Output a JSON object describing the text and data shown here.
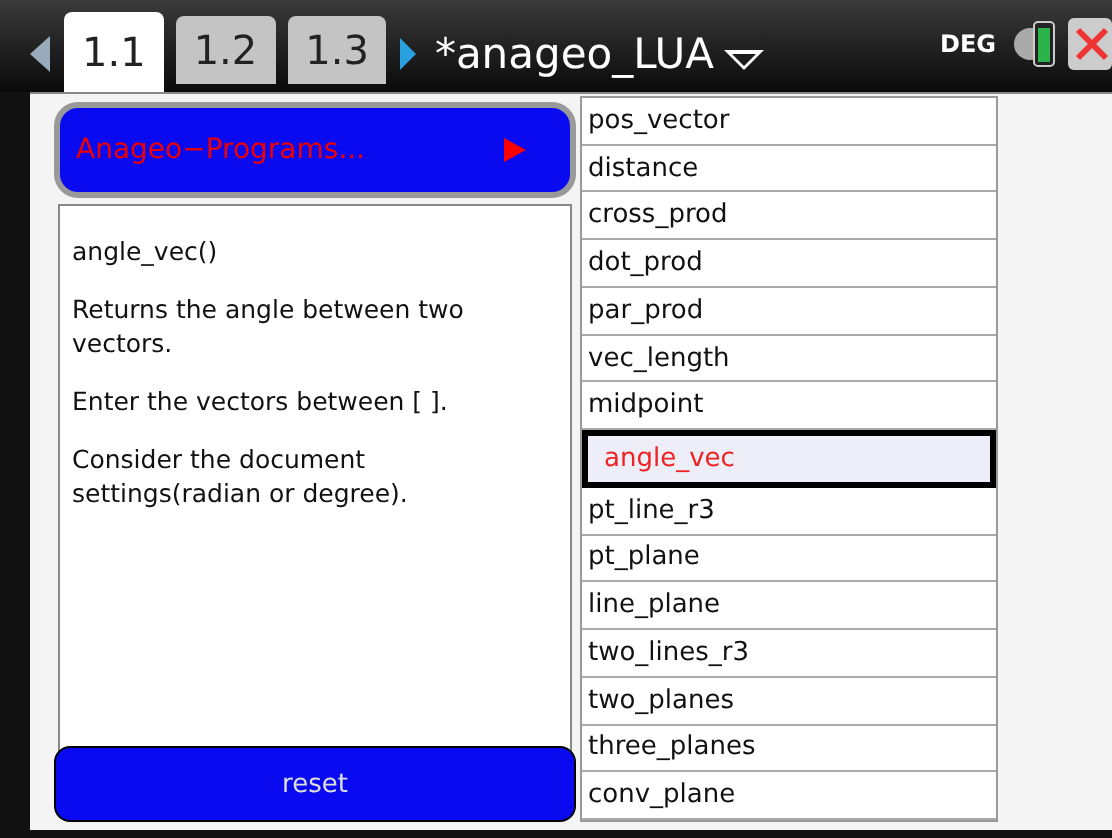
{
  "tabs": [
    {
      "label": "1.1",
      "selected": true
    },
    {
      "label": "1.2",
      "selected": false
    },
    {
      "label": "1.3",
      "selected": false
    }
  ],
  "document_title": "*anageo_LUA",
  "angle_mode": "DEG",
  "menu_button": {
    "label": "Anageo−Programs..."
  },
  "help": {
    "title": "angle_vec()",
    "paragraphs": [
      "Returns the angle between two vectors.",
      "Enter the vectors between [ ].",
      "Consider the document settings(radian or degree)."
    ]
  },
  "reset_button": "reset",
  "functions": [
    {
      "label": "pos_vector",
      "selected": false
    },
    {
      "label": "distance",
      "selected": false
    },
    {
      "label": "cross_prod",
      "selected": false
    },
    {
      "label": "dot_prod",
      "selected": false
    },
    {
      "label": "par_prod",
      "selected": false
    },
    {
      "label": "vec_length",
      "selected": false
    },
    {
      "label": "midpoint",
      "selected": false
    },
    {
      "label": "angle_vec",
      "selected": true
    },
    {
      "label": "pt_line_r3",
      "selected": false
    },
    {
      "label": "pt_plane",
      "selected": false
    },
    {
      "label": "line_plane",
      "selected": false
    },
    {
      "label": "two_lines_r3",
      "selected": false
    },
    {
      "label": "two_planes",
      "selected": false
    },
    {
      "label": "three_planes",
      "selected": false
    },
    {
      "label": "conv_plane",
      "selected": false
    }
  ]
}
